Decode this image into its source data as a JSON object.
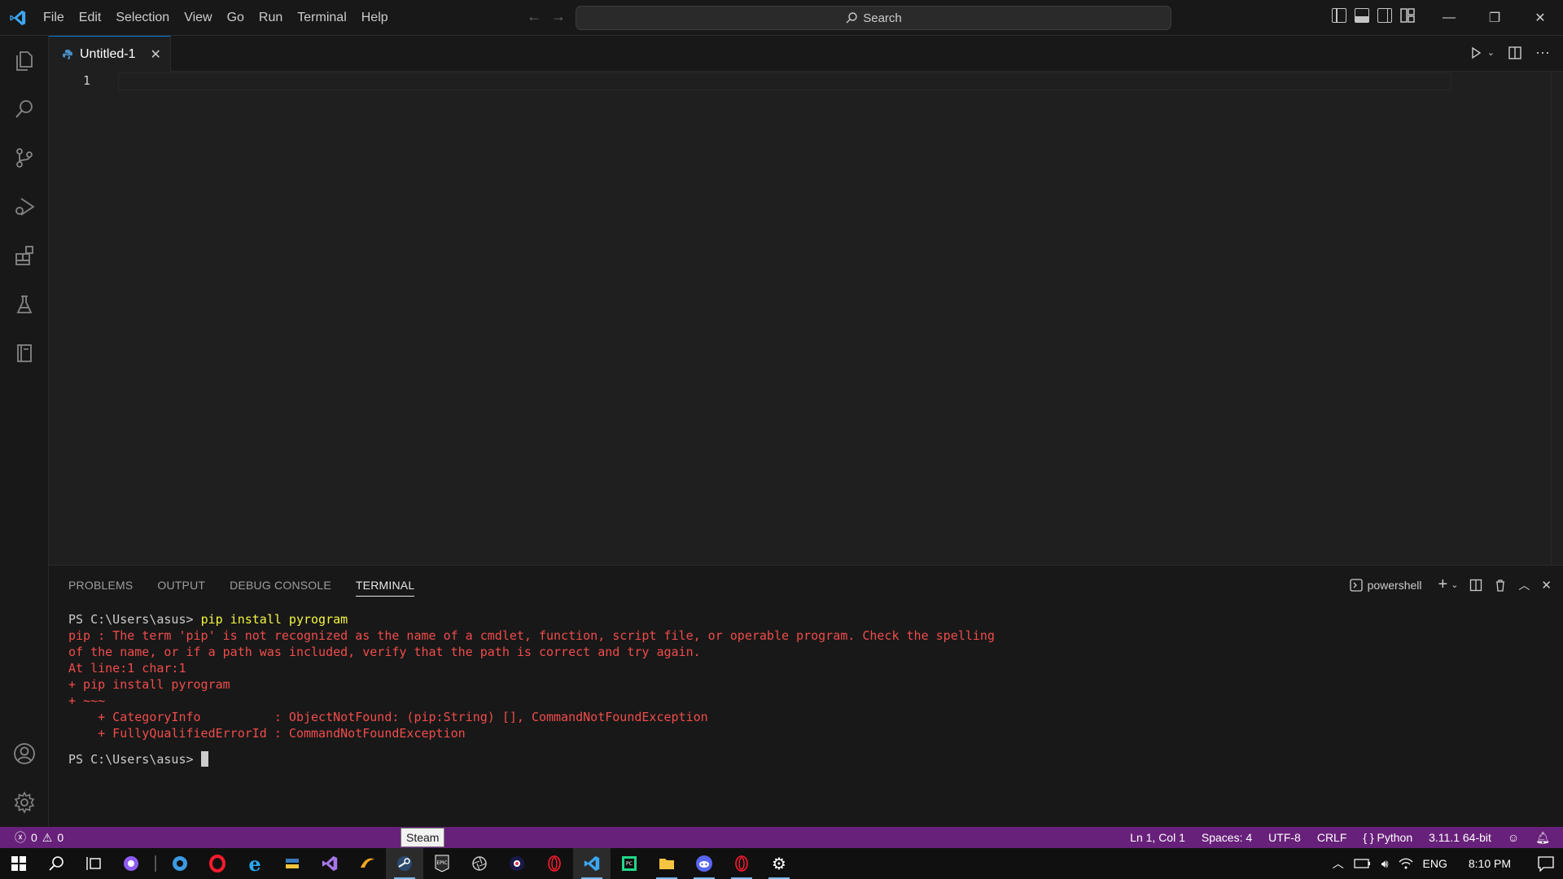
{
  "titlebar": {
    "menu": [
      "File",
      "Edit",
      "Selection",
      "View",
      "Go",
      "Run",
      "Terminal",
      "Help"
    ],
    "search_label": "Search"
  },
  "editor": {
    "tab_title": "Untitled-1",
    "line_number": "1"
  },
  "panel": {
    "tabs": [
      "PROBLEMS",
      "OUTPUT",
      "DEBUG CONSOLE",
      "TERMINAL"
    ],
    "active_tab": "TERMINAL",
    "shell_name": "powershell",
    "terminal": {
      "prompt1": "PS C:\\Users\\asus> ",
      "command": "pip install pyrogram",
      "error_lines": [
        "pip : The term 'pip' is not recognized as the name of a cmdlet, function, script file, or operable program. Check the spelling",
        "of the name, or if a path was included, verify that the path is correct and try again.",
        "At line:1 char:1",
        "+ pip install pyrogram",
        "+ ~~~",
        "    + CategoryInfo          : ObjectNotFound: (pip:String) [], CommandNotFoundException",
        "    + FullyQualifiedErrorId : CommandNotFoundException"
      ],
      "prompt2": "PS C:\\Users\\asus> "
    }
  },
  "statusbar": {
    "errors": "0",
    "warnings": "0",
    "position": "Ln 1, Col 1",
    "spaces": "Spaces: 4",
    "encoding": "UTF-8",
    "eol": "CRLF",
    "language": "Python",
    "interpreter": "3.11.1 64-bit",
    "color": "#68217a"
  },
  "tooltip": "Steam",
  "taskbar": {
    "language": "ENG",
    "time": "8:10 PM"
  },
  "icons": {
    "activity": [
      "explorer-icon",
      "search-icon",
      "source-control-icon",
      "run-debug-icon",
      "extensions-icon",
      "testing-icon",
      "notebook-icon"
    ],
    "activity_bottom": [
      "account-icon",
      "manage-gear-icon"
    ]
  }
}
